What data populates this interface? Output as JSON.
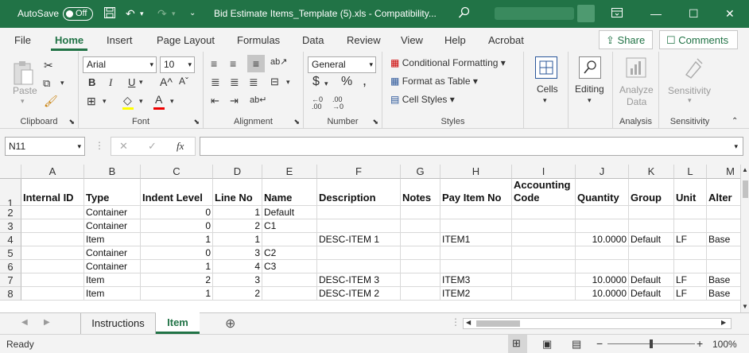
{
  "title": {
    "autosave_label": "AutoSave",
    "autosave_state": "Off",
    "filename": "Bid Estimate Items_Template (5).xls  -  Compatibility..."
  },
  "ribbon_tabs": [
    "File",
    "Home",
    "Insert",
    "Page Layout",
    "Formulas",
    "Data",
    "Review",
    "View",
    "Help",
    "Acrobat"
  ],
  "share_label": "Share",
  "comments_label": "Comments",
  "groups": {
    "clipboard": {
      "paste": "Paste",
      "label": "Clipboard"
    },
    "font": {
      "family": "Arial",
      "size": "10",
      "label": "Font",
      "bold": "B",
      "italic": "I",
      "underline": "U",
      "grow": "A^",
      "shrink": "Aˇ"
    },
    "alignment": {
      "label": "Alignment"
    },
    "number": {
      "format": "General",
      "label": "Number",
      "currency": "$",
      "percent": "%",
      "comma": ","
    },
    "styles": {
      "conditional": "Conditional Formatting",
      "table": "Format as Table",
      "cell": "Cell Styles",
      "label": "Styles"
    },
    "cells": {
      "label": "Cells"
    },
    "editing": {
      "label": "Editing"
    },
    "analysis": {
      "analyze": "Analyze",
      "analyze2": "Data",
      "label": "Analysis"
    },
    "sensitivity": {
      "sens": "Sensitivity",
      "label": "Sensitivity"
    }
  },
  "formula_bar": {
    "name_box": "N11",
    "fx": "fx",
    "formula": ""
  },
  "columns": [
    {
      "letter": "A",
      "header": "Internal ID"
    },
    {
      "letter": "B",
      "header": "Type"
    },
    {
      "letter": "C",
      "header": "Indent Level"
    },
    {
      "letter": "D",
      "header": "Line No"
    },
    {
      "letter": "E",
      "header": "Name"
    },
    {
      "letter": "F",
      "header": "Description"
    },
    {
      "letter": "G",
      "header": "Notes"
    },
    {
      "letter": "H",
      "header": "Pay Item No"
    },
    {
      "letter": "I",
      "header": "Accounting Code"
    },
    {
      "letter": "J",
      "header": "Quantity"
    },
    {
      "letter": "K",
      "header": "Group"
    },
    {
      "letter": "L",
      "header": "Unit"
    },
    {
      "letter": "M",
      "header": "Alter"
    }
  ],
  "rows": [
    {
      "n": "2",
      "cells": [
        "",
        "Container",
        "0",
        "1",
        "Default",
        "",
        "",
        "",
        "",
        "",
        "",
        "",
        ""
      ]
    },
    {
      "n": "3",
      "cells": [
        "",
        "Container",
        "0",
        "2",
        "C1",
        "",
        "",
        "",
        "",
        "",
        "",
        "",
        ""
      ]
    },
    {
      "n": "4",
      "cells": [
        "",
        "Item",
        "1",
        "1",
        "",
        "DESC-ITEM 1",
        "",
        "ITEM1",
        "",
        "10.0000",
        "Default",
        "LF",
        "Base"
      ]
    },
    {
      "n": "5",
      "cells": [
        "",
        "Container",
        "0",
        "3",
        "C2",
        "",
        "",
        "",
        "",
        "",
        "",
        "",
        ""
      ]
    },
    {
      "n": "6",
      "cells": [
        "",
        "Container",
        "1",
        "4",
        "C3",
        "",
        "",
        "",
        "",
        "",
        "",
        "",
        ""
      ]
    },
    {
      "n": "7",
      "cells": [
        "",
        "Item",
        "2",
        "3",
        "",
        "DESC-ITEM 3",
        "",
        "ITEM3",
        "",
        "10.0000",
        "Default",
        "LF",
        "Base"
      ]
    },
    {
      "n": "8",
      "cells": [
        "",
        "Item",
        "1",
        "2",
        "",
        "DESC-ITEM 2",
        "",
        "ITEM2",
        "",
        "10.0000",
        "Default",
        "LF",
        "Base"
      ]
    }
  ],
  "header_row_number": "1",
  "sheets": [
    {
      "name": "Instructions",
      "active": false
    },
    {
      "name": "Item",
      "active": true
    }
  ],
  "status": {
    "ready": "Ready",
    "zoom": "100%",
    "minus": "−",
    "plus": "+"
  },
  "colors": {
    "accent": "#217346"
  }
}
